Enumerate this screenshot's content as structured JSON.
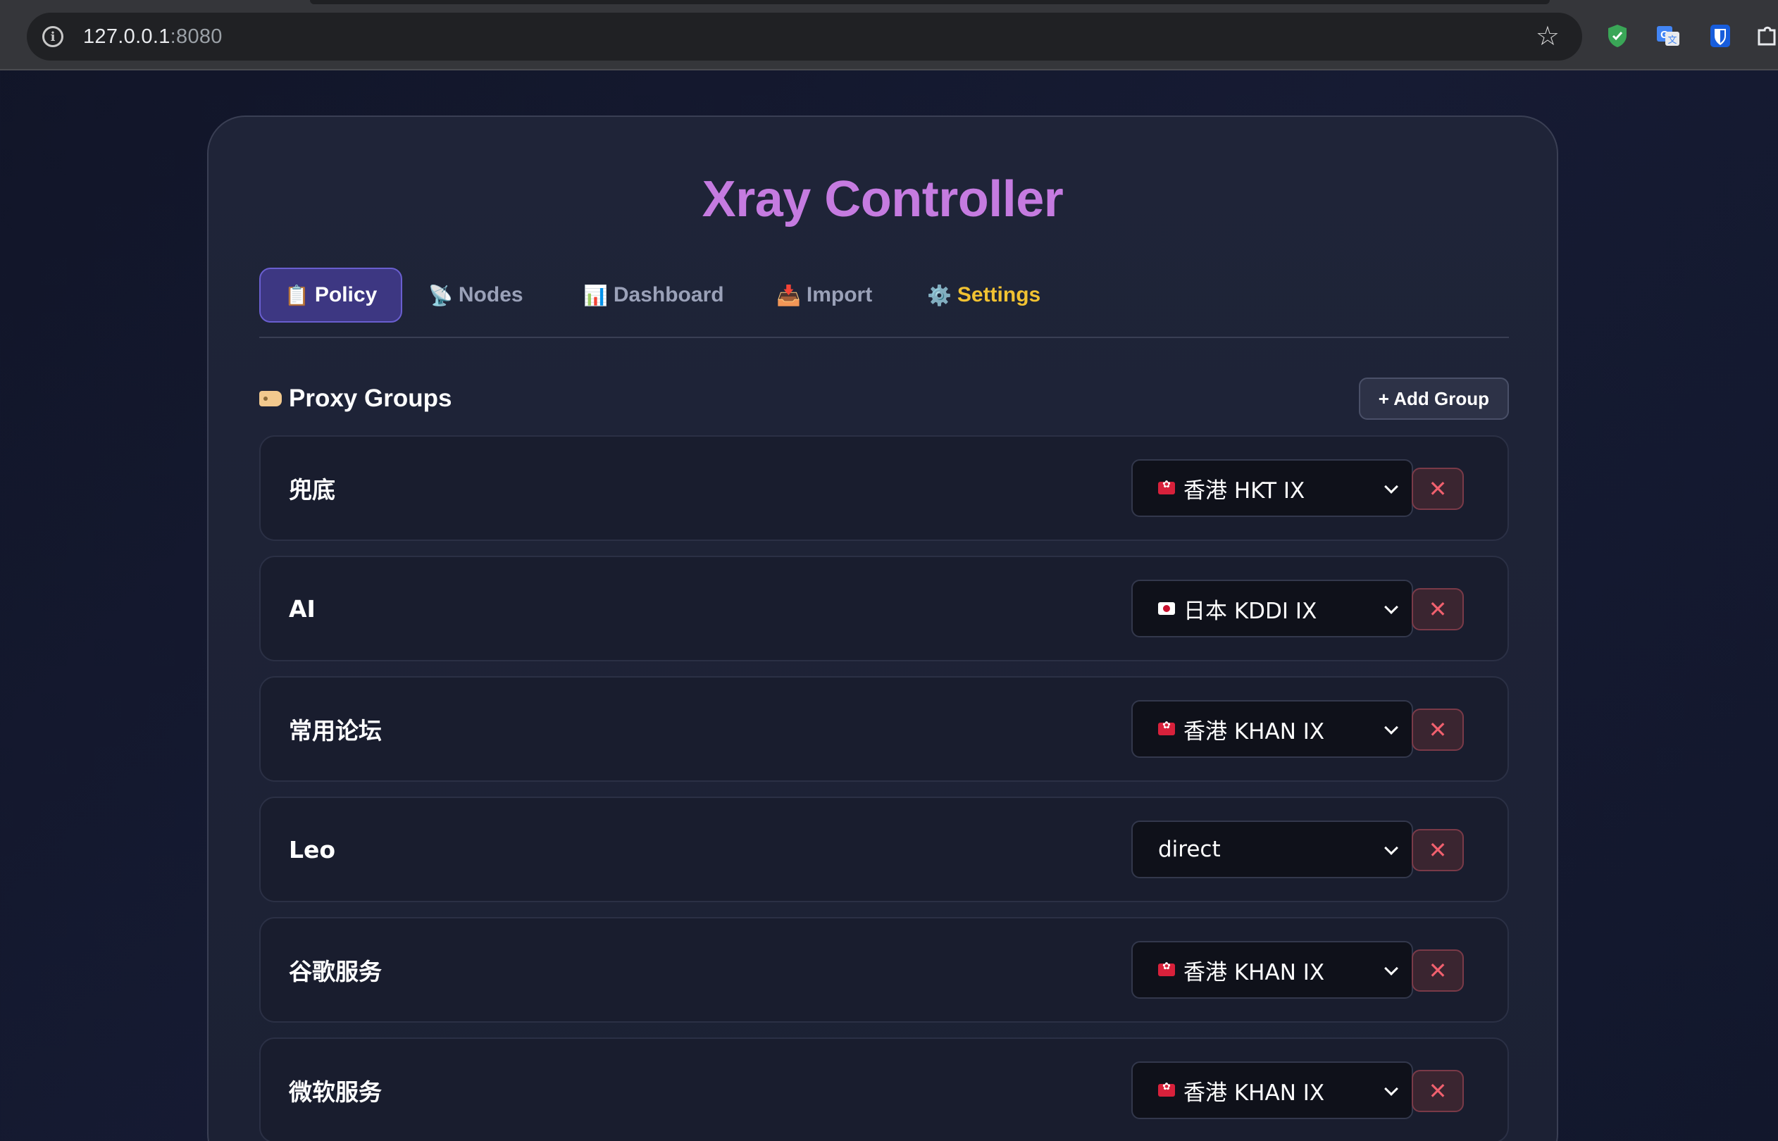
{
  "browser": {
    "url_host": "127.0.0.1",
    "url_port": ":8080",
    "extensions": [
      "shield-check-extension",
      "google-translate-extension",
      "bitwarden-extension",
      "puzzle-extension"
    ]
  },
  "app": {
    "title": "Xray Controller"
  },
  "tabs": [
    {
      "icon": "📋",
      "label": "Policy",
      "active": true
    },
    {
      "icon": "📡",
      "label": "Nodes",
      "active": false
    },
    {
      "icon": "📊",
      "label": "Dashboard",
      "active": false
    },
    {
      "icon": "📥",
      "label": "Import",
      "active": false
    },
    {
      "icon": "⚙️",
      "label": "Settings",
      "active": false
    }
  ],
  "section": {
    "title": "Proxy Groups",
    "add_button": "+ Add Group"
  },
  "groups": [
    {
      "name": "兜底",
      "flag": "hk",
      "selected": "香港 HKT IX"
    },
    {
      "name": "AI",
      "flag": "jp",
      "selected": "日本 KDDI IX"
    },
    {
      "name": "常用论坛",
      "flag": "hk",
      "selected": "香港 KHAN IX"
    },
    {
      "name": "Leo",
      "flag": "",
      "selected": "direct"
    },
    {
      "name": "谷歌服务",
      "flag": "hk",
      "selected": "香港 KHAN IX"
    },
    {
      "name": "微软服务",
      "flag": "hk",
      "selected": "香港 KHAN IX"
    }
  ],
  "colors": {
    "accent_title": "#c57be0",
    "active_tab_bg": "#3d3782",
    "settings_tab": "#f1c232",
    "delete_red": "#f0606e"
  }
}
